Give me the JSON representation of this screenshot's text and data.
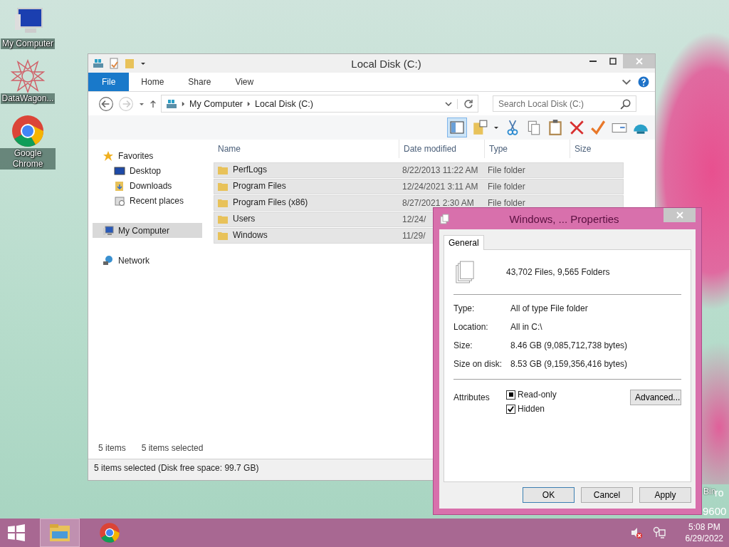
{
  "desktop_icons": [
    {
      "kind": "computer",
      "label": "My Computer"
    },
    {
      "kind": "star",
      "label": "DataWagon..."
    },
    {
      "kind": "chrome",
      "label": "Google Chrome"
    }
  ],
  "desktop_texts": [
    "Bin",
    "ro",
    "9600"
  ],
  "explorer": {
    "title": "Local Disk (C:)",
    "ribbon_tabs": [
      {
        "label": "File",
        "selected": true
      },
      {
        "label": "Home",
        "selected": false
      },
      {
        "label": "Share",
        "selected": false
      },
      {
        "label": "View",
        "selected": false
      }
    ],
    "breadcrumb": [
      "My Computer",
      "Local Disk (C:)"
    ],
    "search": {
      "placeholder": "Search Local Disk (C:)"
    },
    "nav": [
      {
        "label": "Favorites",
        "kind": "star",
        "selected": false,
        "children": [
          {
            "label": "Desktop",
            "kind": "desktop",
            "selected": false
          },
          {
            "label": "Downloads",
            "kind": "folder",
            "selected": false
          },
          {
            "label": "Recent places",
            "kind": "recent",
            "selected": false
          }
        ]
      },
      {
        "label": "My Computer",
        "kind": "computer",
        "selected": true
      },
      {
        "label": "Network",
        "kind": "network",
        "selected": false
      }
    ],
    "columns": [
      "Name",
      "Date modified",
      "Type",
      "Size"
    ],
    "rows": [
      {
        "name": "PerfLogs",
        "date": "8/22/2013 11:22 AM",
        "type": "File folder",
        "selected": true
      },
      {
        "name": "Program Files",
        "date": "12/24/2021 3:11 AM",
        "type": "File folder",
        "selected": true
      },
      {
        "name": "Program Files (x86)",
        "date": "8/27/2021 2:30 AM",
        "type": "File folder",
        "selected": true
      },
      {
        "name": "Users",
        "date": "12/24/",
        "selected": true
      },
      {
        "name": "Windows",
        "date": "11/29/",
        "selected": true
      }
    ],
    "item_count": "5 items",
    "selected_count": "5 items selected",
    "status_bar": "5 items selected (Disk free space: 99.7 GB)"
  },
  "properties": {
    "title": "Windows, ... Properties",
    "tabs": [
      {
        "label": "General",
        "selected": true
      }
    ],
    "summary": "43,702 Files, 9,565 Folders",
    "fields": [
      {
        "label": "Type:",
        "value": "All of type File folder"
      },
      {
        "label": "Location:",
        "value": "All in C:\\"
      },
      {
        "label": "Size:",
        "value": "8.46 GB (9,085,712,738 bytes)"
      },
      {
        "label": "Size on disk:",
        "value": "8.53 GB (9,159,356,416 bytes)"
      }
    ],
    "attributes_label": "Attributes",
    "attributes": [
      {
        "label": "Read-only",
        "indeterminate": true
      },
      {
        "label": "Hidden",
        "checked": true
      }
    ],
    "advanced_button": "Advanced...",
    "buttons": [
      {
        "label": "OK",
        "default": true
      },
      {
        "label": "Cancel",
        "default": false
      },
      {
        "label": "Apply",
        "default": false
      }
    ]
  },
  "taskbar": {
    "apps": [
      {
        "kind": "explorer",
        "selected": true
      },
      {
        "kind": "chrome",
        "selected": false
      }
    ],
    "time": "5:08 PM",
    "date": "6/29/2022"
  }
}
